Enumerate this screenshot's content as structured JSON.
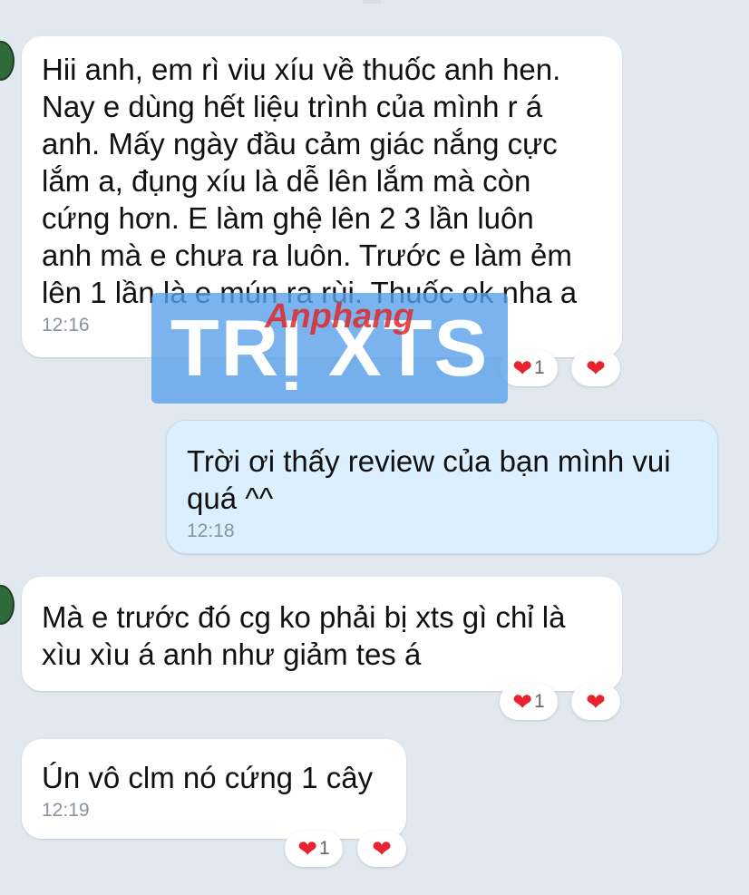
{
  "messages": [
    {
      "text": "Hii anh, em rì viu xíu về thuốc anh hen.\nNay e dùng hết liệu trình của mình r á\nanh. Mấy ngày đầu cảm giác nắng cực\nlắm a, đụng xíu là dễ lên lắm mà còn\ncứng hơn. E làm ghệ lên 2 3 lần luôn\nanh mà e chưa ra luôn. Trước e làm ẻm\nlên 1 lần là e mún ra rùi. Thuốc ok nha a",
      "time": "12:16",
      "reaction_count": "1"
    },
    {
      "text": "Trời ơi thấy review của bạn mình vui\nquá ^^",
      "time": "12:18"
    },
    {
      "text": "Mà e trước đó cg ko phải bị xts gì chỉ là\nxìu xìu á anh như giảm tes á",
      "reaction_count": "1"
    },
    {
      "text": "Ún vô clm nó cứng 1 cây",
      "time": "12:19",
      "reaction_count": "1"
    }
  ],
  "icons": {
    "reaction": "heart-icon",
    "heart_glyph": "❤"
  },
  "watermark": {
    "text": "TRỊ XTS",
    "brand": "Anphang"
  },
  "colors": {
    "background": "#e2e8ef",
    "incoming_bubble": "#ffffff",
    "outgoing_bubble": "#dcefff",
    "heart": "#e8232e",
    "watermark": "#5aa0eb"
  }
}
